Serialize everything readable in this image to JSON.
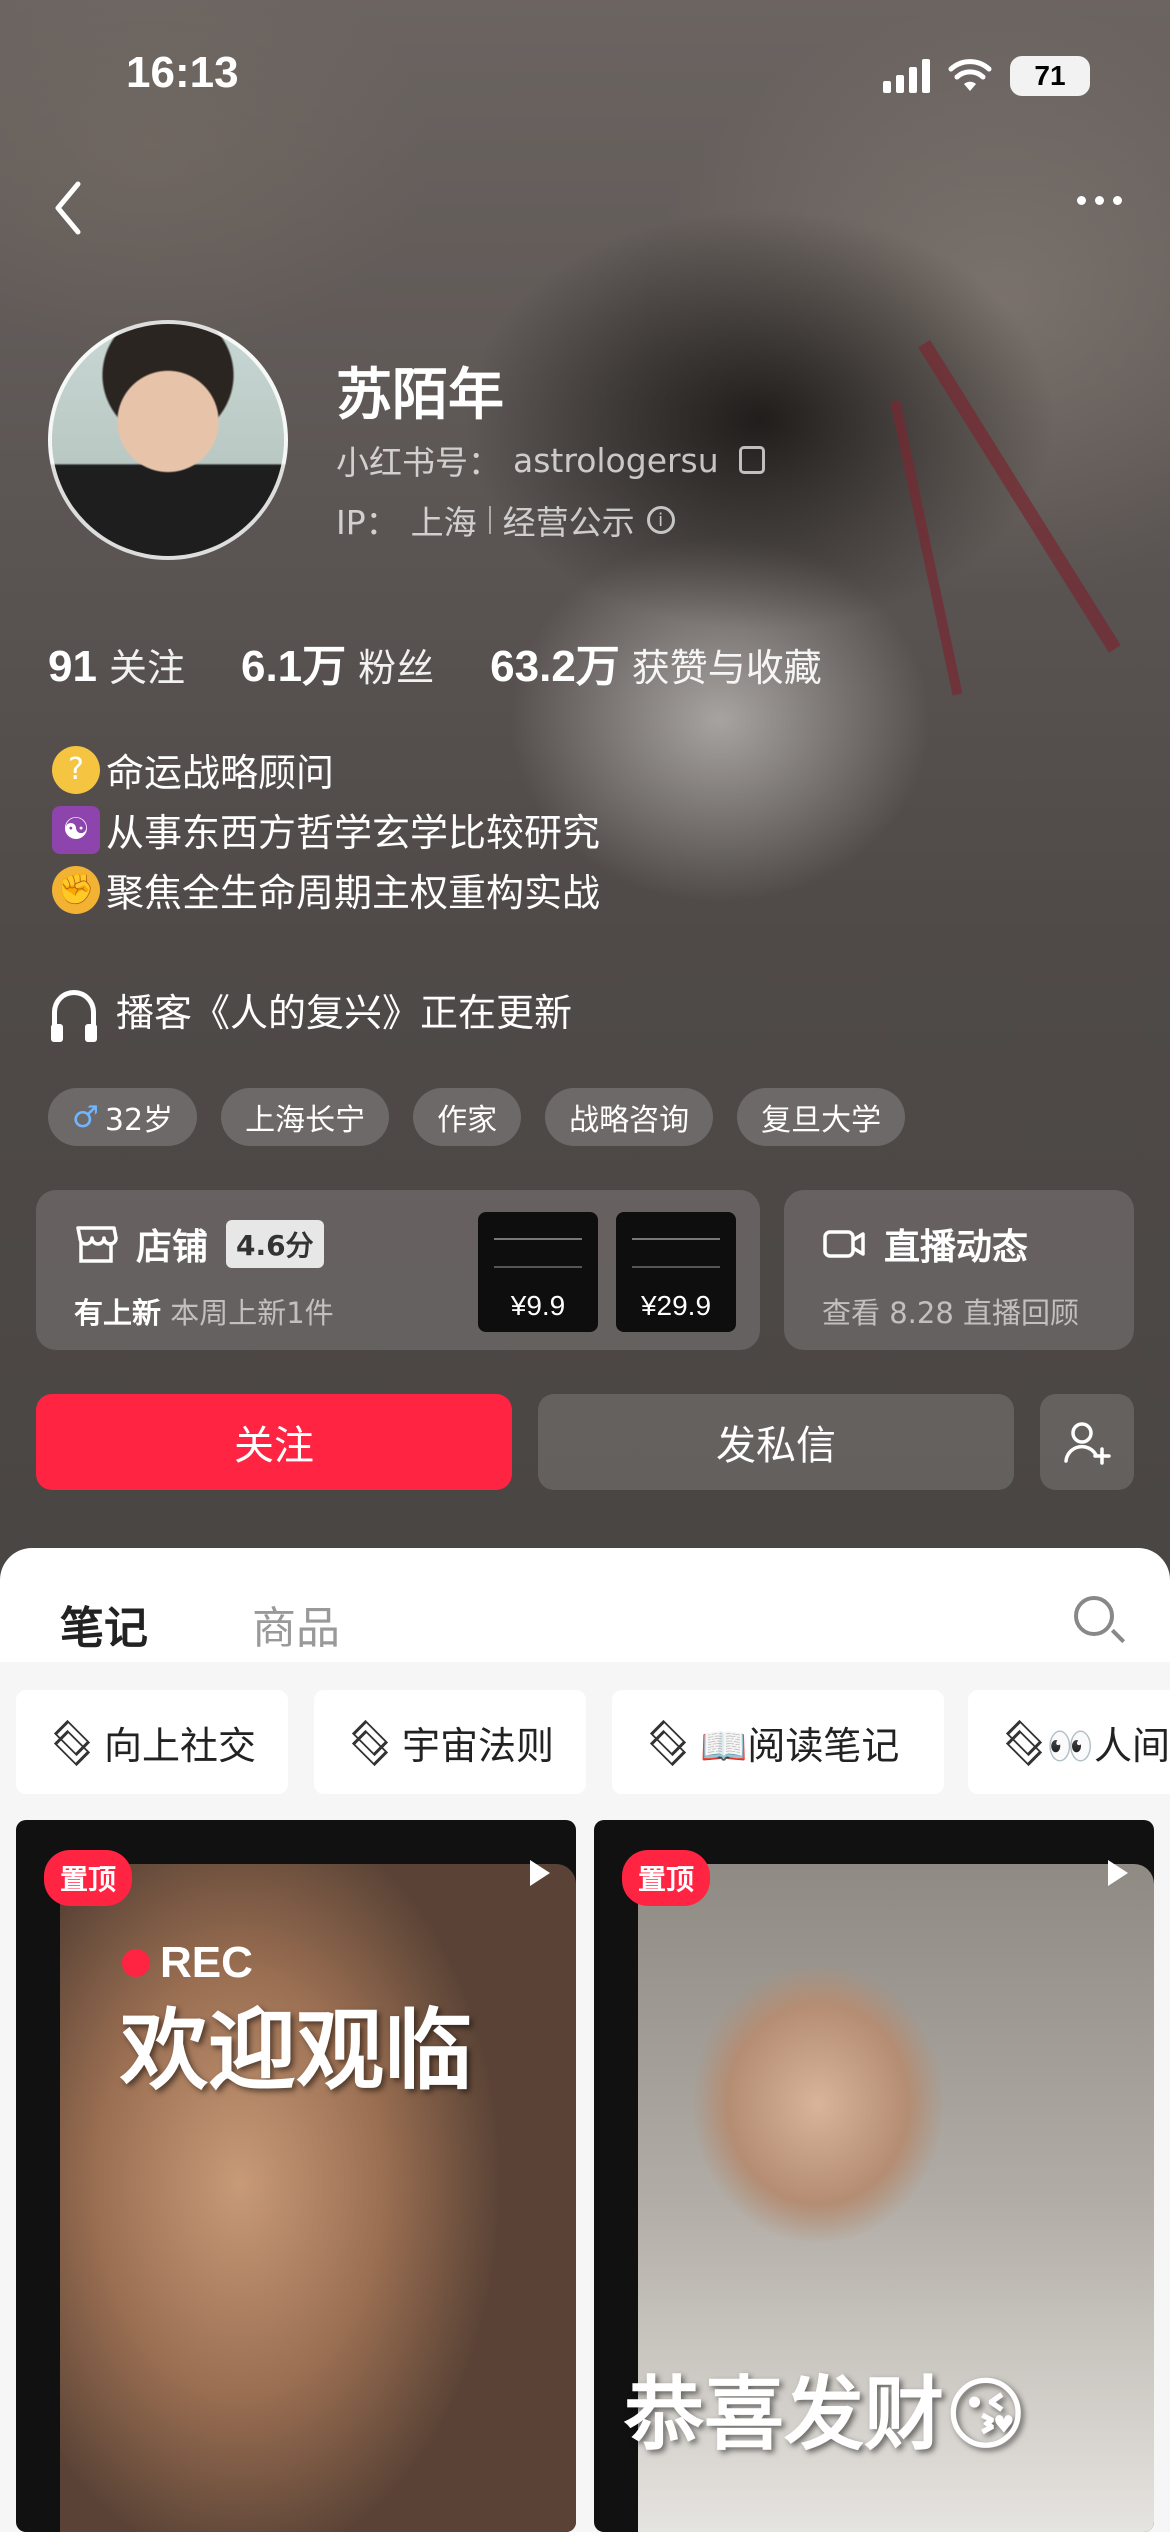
{
  "status_bar": {
    "time": "16:13",
    "battery": "71"
  },
  "profile": {
    "nickname": "苏陌年",
    "id_label": "小红书号：",
    "id_value": "astrologersu",
    "ip_label": "IP：",
    "ip_value": "上海",
    "business_notice": "经营公示"
  },
  "stats": [
    {
      "value": "91",
      "label": "关注"
    },
    {
      "value": "6.1万",
      "label": "粉丝"
    },
    {
      "value": "63.2万",
      "label": "获赞与收藏"
    }
  ],
  "bio": {
    "line1": "命运战略顾问",
    "line2": "从事东西方哲学玄学比较研究",
    "line3": "聚焦全生命周期主权重构实战",
    "podcast": "播客《人的复兴》正在更新"
  },
  "tags": [
    "32岁",
    "上海长宁",
    "作家",
    "战略咨询",
    "复旦大学"
  ],
  "shop_card": {
    "title": "店铺",
    "score": "4.6分",
    "sub_bold": "有上新",
    "sub": "本周上新1件",
    "prices": [
      "¥9.9",
      "¥29.9"
    ]
  },
  "live_card": {
    "title": "直播动态",
    "sub": "查看 8.28 直播回顾"
  },
  "actions": {
    "follow": "关注",
    "message": "发私信"
  },
  "content_tabs": {
    "notes": "笔记",
    "goods": "商品"
  },
  "collections": [
    "向上社交",
    "宇宙法则",
    "📖阅读笔记",
    "👀人间"
  ],
  "notes": [
    {
      "pin": "置顶",
      "rec": "REC",
      "overlay": "欢迎观临"
    },
    {
      "pin": "置顶",
      "overlay": "恭喜发财😘"
    }
  ],
  "colors": {
    "accent": "#ff2442"
  }
}
